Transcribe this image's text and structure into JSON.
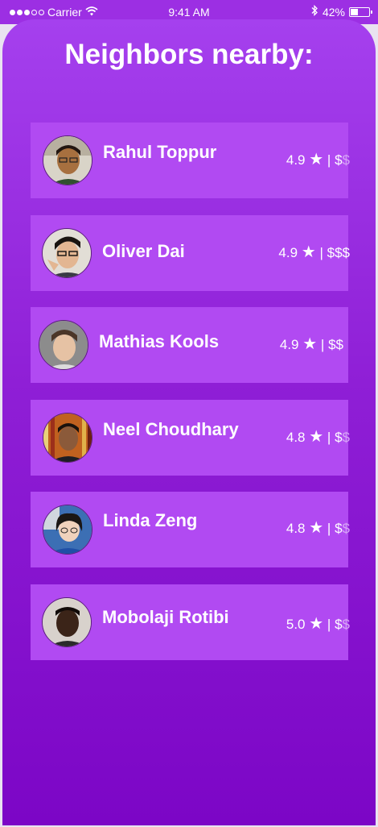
{
  "status_bar": {
    "carrier": "Carrier",
    "time": "9:41 AM",
    "battery": "42%",
    "battery_level": 0.42
  },
  "page": {
    "title": "Neighbors nearby:"
  },
  "neighbors": [
    {
      "name": "Rahul Toppur",
      "rating": "4.9",
      "star": "★",
      "sep": "|",
      "price_active": "$",
      "price_dim": "$"
    },
    {
      "name": "Oliver Dai",
      "rating": "4.9",
      "star": "★",
      "sep": "|",
      "price_active": "$$$",
      "price_dim": ""
    },
    {
      "name": "Mathias Kools",
      "rating": "4.9",
      "star": "★",
      "sep": "|",
      "price_active": "$$",
      "price_dim": ""
    },
    {
      "name": "Neel Choudhary",
      "rating": "4.8",
      "star": "★",
      "sep": "|",
      "price_active": "$",
      "price_dim": "$"
    },
    {
      "name": "Linda Zeng",
      "rating": "4.8",
      "star": "★",
      "sep": "|",
      "price_active": "$",
      "price_dim": "$"
    },
    {
      "name": "Mobolaji Rotibi",
      "rating": "5.0",
      "star": "★",
      "sep": "|",
      "price_active": "$",
      "price_dim": "$"
    }
  ],
  "colors": {
    "gradient_top": "#a540ee",
    "gradient_bottom": "#7c06c6",
    "row_background": "#b14af2",
    "dim_price": "#d7a4f6"
  }
}
